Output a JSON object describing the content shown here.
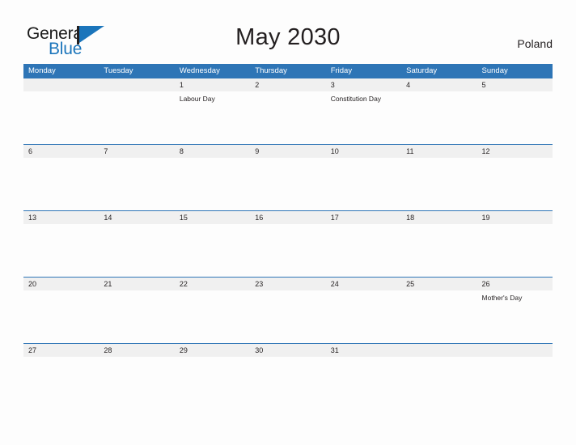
{
  "logo": {
    "word_one": "General",
    "word_two": "Blue",
    "flag_icon": "blue-flag-icon",
    "accent_color": "#1b75bb"
  },
  "header": {
    "title": "May 2030",
    "country": "Poland"
  },
  "theme": {
    "header_blue": "#2e75b6",
    "date_band_gray": "#f0f0f0",
    "page_background": "#fdfdfd",
    "text_color": "#231f20"
  },
  "calendar": {
    "weekdays": [
      "Monday",
      "Tuesday",
      "Wednesday",
      "Thursday",
      "Friday",
      "Saturday",
      "Sunday"
    ],
    "weeks": [
      {
        "days": [
          {
            "date": "",
            "event": ""
          },
          {
            "date": "",
            "event": ""
          },
          {
            "date": "1",
            "event": "Labour Day"
          },
          {
            "date": "2",
            "event": ""
          },
          {
            "date": "3",
            "event": "Constitution Day"
          },
          {
            "date": "4",
            "event": ""
          },
          {
            "date": "5",
            "event": ""
          }
        ]
      },
      {
        "days": [
          {
            "date": "6",
            "event": ""
          },
          {
            "date": "7",
            "event": ""
          },
          {
            "date": "8",
            "event": ""
          },
          {
            "date": "9",
            "event": ""
          },
          {
            "date": "10",
            "event": ""
          },
          {
            "date": "11",
            "event": ""
          },
          {
            "date": "12",
            "event": ""
          }
        ]
      },
      {
        "days": [
          {
            "date": "13",
            "event": ""
          },
          {
            "date": "14",
            "event": ""
          },
          {
            "date": "15",
            "event": ""
          },
          {
            "date": "16",
            "event": ""
          },
          {
            "date": "17",
            "event": ""
          },
          {
            "date": "18",
            "event": ""
          },
          {
            "date": "19",
            "event": ""
          }
        ]
      },
      {
        "days": [
          {
            "date": "20",
            "event": ""
          },
          {
            "date": "21",
            "event": ""
          },
          {
            "date": "22",
            "event": ""
          },
          {
            "date": "23",
            "event": ""
          },
          {
            "date": "24",
            "event": ""
          },
          {
            "date": "25",
            "event": ""
          },
          {
            "date": "26",
            "event": "Mother's Day"
          }
        ]
      },
      {
        "days": [
          {
            "date": "27",
            "event": ""
          },
          {
            "date": "28",
            "event": ""
          },
          {
            "date": "29",
            "event": ""
          },
          {
            "date": "30",
            "event": ""
          },
          {
            "date": "31",
            "event": ""
          },
          {
            "date": "",
            "event": ""
          },
          {
            "date": "",
            "event": ""
          }
        ]
      }
    ]
  }
}
